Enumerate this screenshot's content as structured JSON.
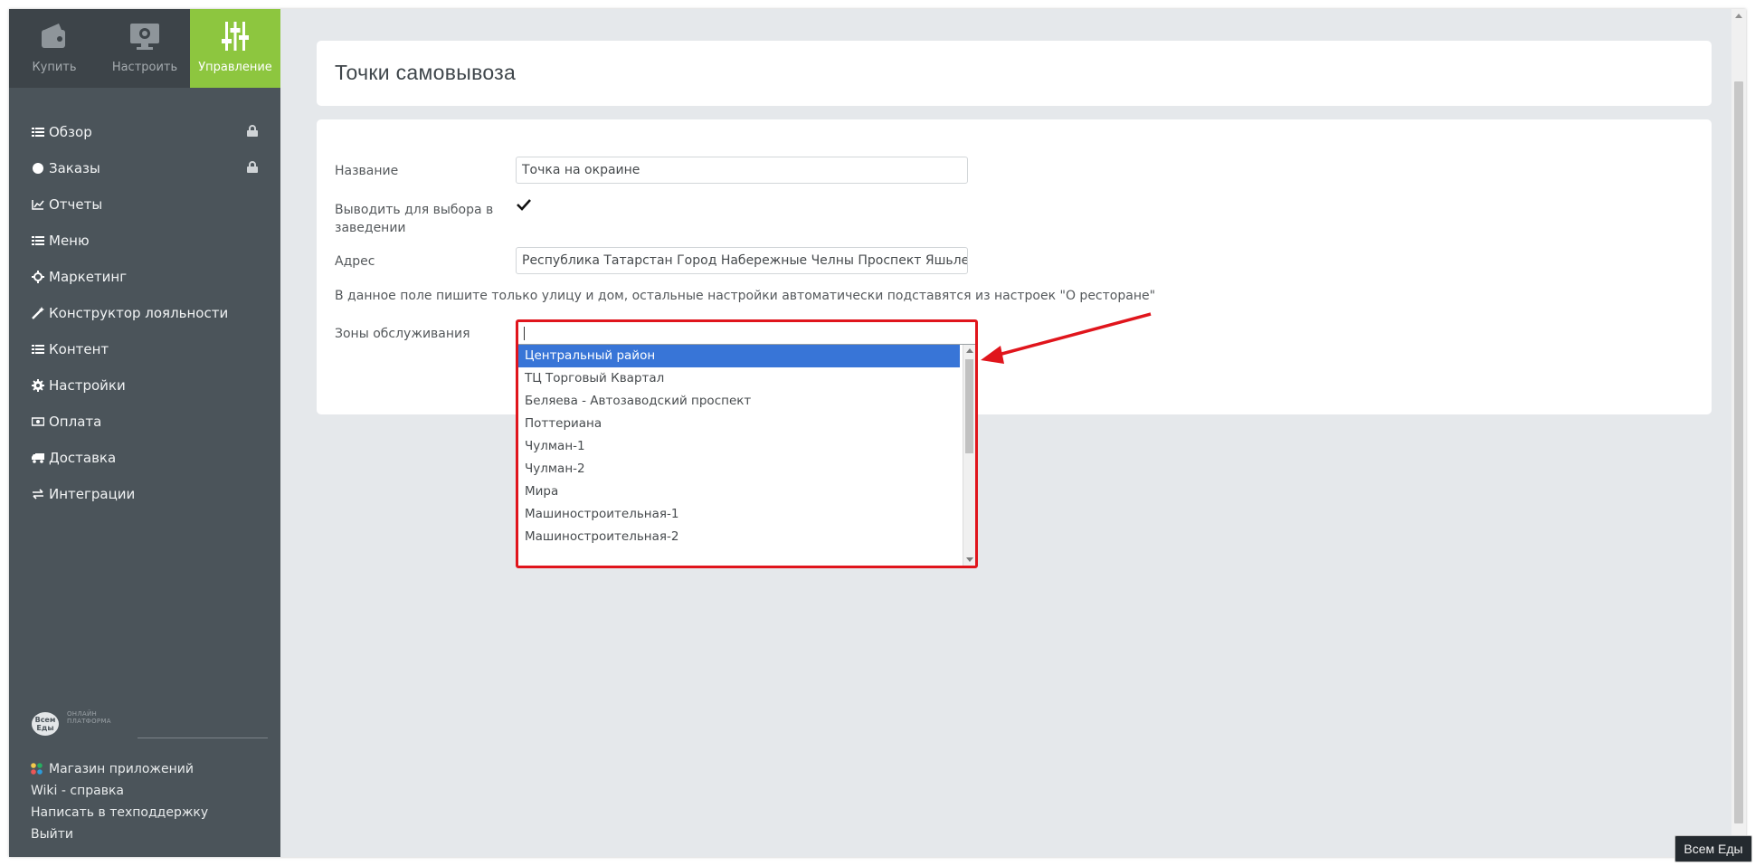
{
  "topnav": [
    {
      "label": "Купить",
      "icon": "wallet-icon"
    },
    {
      "label": "Настроить",
      "icon": "monitor-gear-icon"
    },
    {
      "label": "Управление",
      "icon": "sliders-icon",
      "active": true
    }
  ],
  "menu": [
    {
      "label": "Обзор",
      "icon": "list-icon",
      "locked": true
    },
    {
      "label": "Заказы",
      "icon": "circle-icon",
      "locked": true
    },
    {
      "label": "Отчеты",
      "icon": "line-chart-icon"
    },
    {
      "label": "Меню",
      "icon": "list-icon"
    },
    {
      "label": "Маркетинг",
      "icon": "crosshair-icon"
    },
    {
      "label": "Конструктор лояльности",
      "icon": "magic-wand-icon"
    },
    {
      "label": "Контент",
      "icon": "list-icon"
    },
    {
      "label": "Настройки",
      "icon": "gear-icon"
    },
    {
      "label": "Оплата",
      "icon": "money-icon"
    },
    {
      "label": "Доставка",
      "icon": "truck-icon"
    },
    {
      "label": "Интеграции",
      "icon": "exchange-icon"
    }
  ],
  "brand": {
    "logo_text": "Всем Еды",
    "tagline_1": "ОНЛАЙН",
    "tagline_2": "ПЛАТФОРМА"
  },
  "bottom_links": [
    "Магазин приложений",
    "Wiki - справка",
    "Написать в техподдержку",
    "Выйти"
  ],
  "page_title": "Точки самовывоза",
  "form": {
    "name_label": "Название",
    "name_value": "Точка на окраине",
    "show_label": "Выводить для выбора в заведении",
    "show_checked": true,
    "address_label": "Адрес",
    "address_value": "Республика Татарстан Город Набережные Челны Проспект Яшьлек",
    "address_hint": "В данное поле пишите только улицу и дом, остальные настройки автоматически подставятся из настроек \"О ресторане\"",
    "zones_label": "Зоны обслуживания"
  },
  "zones_dropdown": {
    "options": [
      "Центральный район",
      "ТЦ Торговый Квартал",
      "Беляева - Автозаводский проспект",
      "Поттериана",
      "Чулман-1",
      "Чулман-2",
      "Мира",
      "Машиностроительная-1",
      "Машиностроительная-2"
    ],
    "selected_index": 0
  },
  "tooltip": "Всем Еды",
  "colors": {
    "accent": "#8dc63f",
    "sidebar": "#4b545a",
    "highlight": "#3875d7",
    "annotation": "#e0151c"
  }
}
